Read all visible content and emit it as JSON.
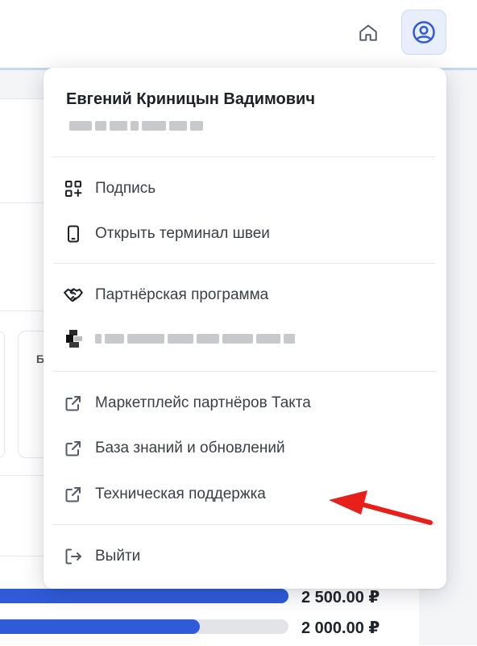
{
  "header": {
    "icons": [
      "home-icon",
      "user-circle-icon"
    ],
    "accent": "#2f5bd8"
  },
  "user_menu": {
    "user_name": "Евгений Криницын Вадимович",
    "items": [
      {
        "label": "Подпись",
        "icon": "qr-code-icon"
      },
      {
        "label": "Открыть терминал швеи",
        "icon": "mobile-phone-icon"
      },
      {
        "label": "Партнёрская программа",
        "icon": "handshake-icon"
      },
      {
        "label": "Маркетплейс партнёров Такта",
        "icon": "external-link-icon"
      },
      {
        "label": "База знаний и обновлений",
        "icon": "external-link-icon"
      },
      {
        "label": "Техническая поддержка",
        "icon": "external-link-icon"
      },
      {
        "label": "Выйти",
        "icon": "logout-icon"
      }
    ]
  },
  "background": {
    "bars": [
      {
        "value": "2 500.00 ₽",
        "fill": 1.0
      },
      {
        "value": "2 000.00 ₽",
        "fill": 0.7
      }
    ],
    "card_letter": "Б"
  }
}
